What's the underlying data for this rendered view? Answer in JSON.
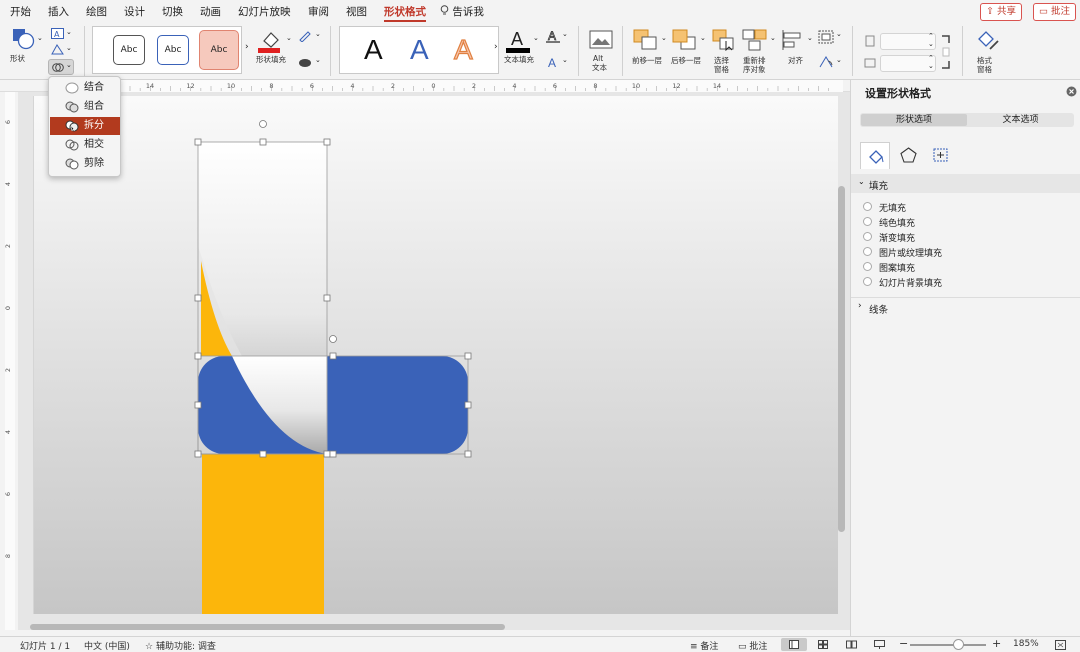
{
  "menu": {
    "tabs": [
      "开始",
      "插入",
      "绘图",
      "设计",
      "切换",
      "动画",
      "幻灯片放映",
      "审阅",
      "视图",
      "形状格式"
    ],
    "active_tab": "形状格式",
    "tell_me": "告诉我",
    "share": "共享",
    "comment": "批注"
  },
  "ribbon": {
    "shape_label": "形状",
    "style_samples": [
      "Abc",
      "Abc",
      "Abc"
    ],
    "shape_fill_label": "形状填充",
    "wordart_samples": [
      "A",
      "A",
      "A"
    ],
    "text_fill_label": "文本填充",
    "alt_text_line1": "Alt",
    "alt_text_line2": "文本",
    "bring_forward": "前移一层",
    "send_backward": "后移一层",
    "selection_pane_line1": "选择",
    "selection_pane_line2": "窗格",
    "reorder_line1": "重新排",
    "reorder_line2": "序对象",
    "align": "对齐",
    "format_pane_line1": "格式",
    "format_pane_line2": "窗格",
    "accent_color": "#c0392b"
  },
  "merge_menu": {
    "items": [
      "结合",
      "组合",
      "拆分",
      "相交",
      "剪除"
    ],
    "selected": "拆分"
  },
  "ruler": {
    "top_ticks": [
      "14",
      "12",
      "10",
      "8",
      "6",
      "4",
      "2",
      "0",
      "2",
      "4",
      "6",
      "8",
      "10",
      "12",
      "14"
    ],
    "left_ticks": [
      "6",
      "4",
      "2",
      "0",
      "2",
      "4",
      "6",
      "8"
    ]
  },
  "slide_shapes": {
    "blue_color": "#3a62b8",
    "orange_color": "#fcb60b"
  },
  "format_pane": {
    "title": "设置形状格式",
    "tab_shape": "形状选项",
    "tab_text": "文本选项",
    "fill_section": "填充",
    "fill_options": [
      "无填充",
      "纯色填充",
      "渐变填充",
      "图片或纹理填充",
      "图案填充",
      "幻灯片背景填充"
    ],
    "line_section": "线条"
  },
  "status": {
    "slide": "幻灯片 1 / 1",
    "language": "中文 (中国)",
    "accessibility": "辅助功能: 调查",
    "notes": "备注",
    "comments": "批注",
    "zoom": "185%"
  }
}
